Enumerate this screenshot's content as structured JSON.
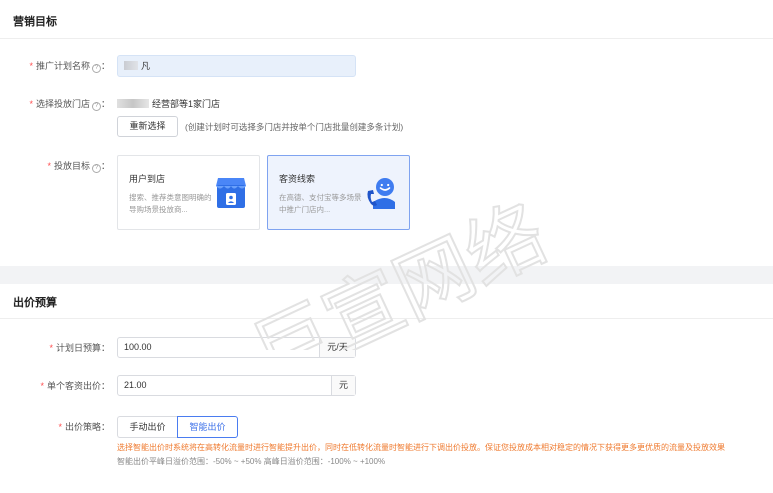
{
  "marketing": {
    "title": "营销目标",
    "plan_name": {
      "label": "推广计划名称",
      "value": "凡"
    },
    "stores": {
      "label": "选择投放门店",
      "value": "经营部等1家门店",
      "reselect_label": "重新选择",
      "hint": "(创建计划时可选择多门店并按单个门店批量创建多条计划)"
    },
    "target": {
      "label": "投放目标",
      "cards": [
        {
          "title": "用户到店",
          "desc": "搜索、推荐类意图明确的导购场景投放商..."
        },
        {
          "title": "客资线索",
          "desc": "在高德、支付宝等多场景中推广门店内..."
        }
      ]
    }
  },
  "bidding": {
    "title": "出价预算",
    "daily_budget": {
      "label": "计划日预算",
      "value": "100.00",
      "unit": "元/天"
    },
    "single_bid": {
      "label": "单个客资出价",
      "value": "21.00",
      "unit": "元"
    },
    "strategy": {
      "label": "出价策略",
      "options": [
        "手动出价",
        "智能出价"
      ],
      "selected": "智能出价",
      "warning": "选择智能出价时系统将在高转化流量时进行智能提升出价，同时在低转化流量时智能进行下调出价投放。保证您投放成本相对稳定的情况下获得更多更优质的流量及投放效果",
      "range": "智能出价平峰日溢价范围：-50% ~ +50% 高峰日溢价范围：-100% ~ +100%"
    }
  },
  "watermark": "巨宣网络",
  "colors": {
    "accent": "#3b6fe8",
    "required": "#ff4d4f",
    "warning": "#ef7a2f",
    "selected_card": "#eef3fd"
  },
  "icons": {
    "store": "store-icon",
    "lead": "customer-service-icon",
    "help": "question-circle-icon"
  }
}
